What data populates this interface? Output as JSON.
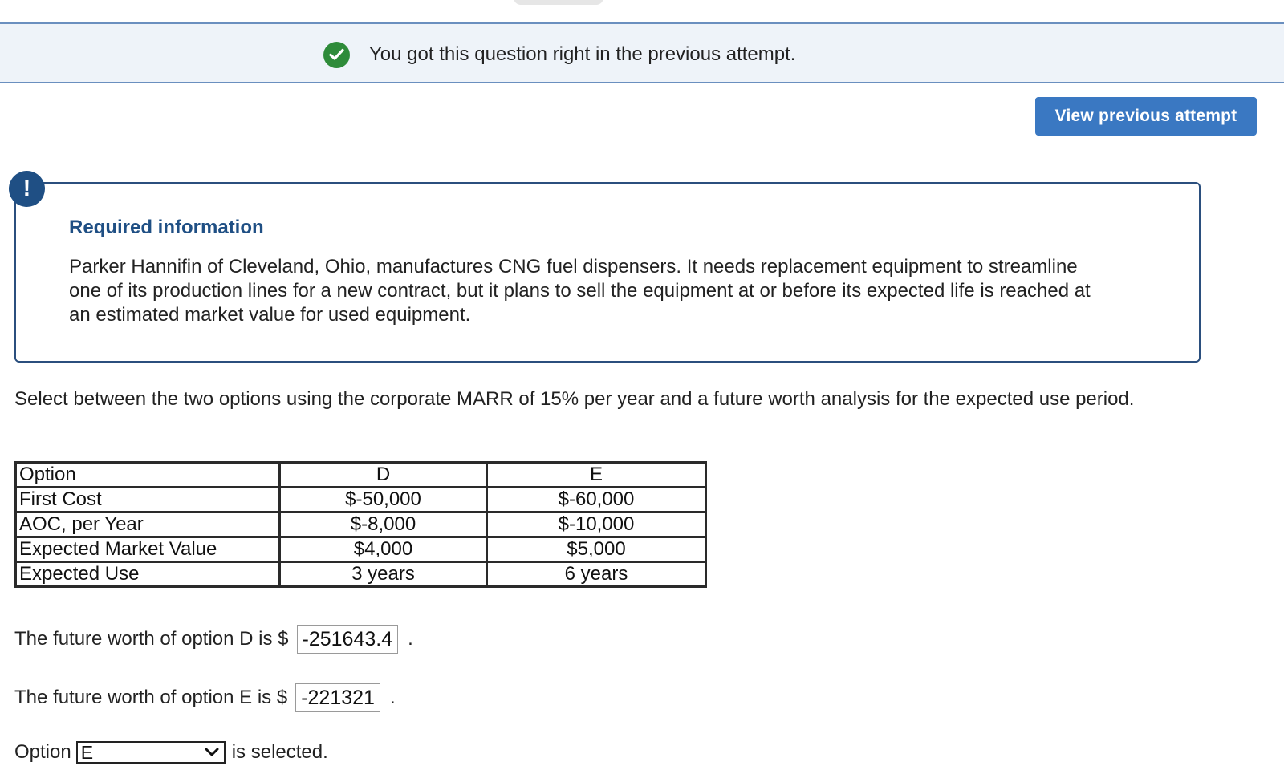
{
  "banner": {
    "icon": "check-circle-icon",
    "message": "You got this question right in the previous attempt.",
    "color": "#2e8b3a"
  },
  "actions": {
    "view_previous_label": "View previous attempt",
    "button_color": "#3a78c2"
  },
  "required_info": {
    "icon": "exclamation-icon",
    "title": "Required information",
    "body": "Parker Hannifin of Cleveland, Ohio, manufactures CNG fuel dispensers. It needs replacement equipment to streamline one of its production lines for a new contract, but it plans to sell the equipment at or before its expected life is reached at an estimated market value for used equipment."
  },
  "question": {
    "text": "Select between the two options using the corporate MARR of 15% per year and a future worth analysis for the expected use period."
  },
  "table": {
    "rows": [
      [
        "Option",
        "D",
        "E"
      ],
      [
        "First Cost",
        "$-50,000",
        "$-60,000"
      ],
      [
        "AOC, per Year",
        "$-8,000",
        "$-10,000"
      ],
      [
        "Expected Market Value",
        "$4,000",
        "$5,000"
      ],
      [
        "Expected Use",
        "3 years",
        "6 years"
      ]
    ]
  },
  "answers": {
    "fw_d_prefix": "The future worth of option D is $",
    "fw_d_value": "-251643.4",
    "fw_e_prefix": "The future worth of option E is $",
    "fw_e_value": "-221321",
    "period": "."
  },
  "selection": {
    "prefix": "Option",
    "selected_value": "E",
    "suffix": "is selected."
  }
}
